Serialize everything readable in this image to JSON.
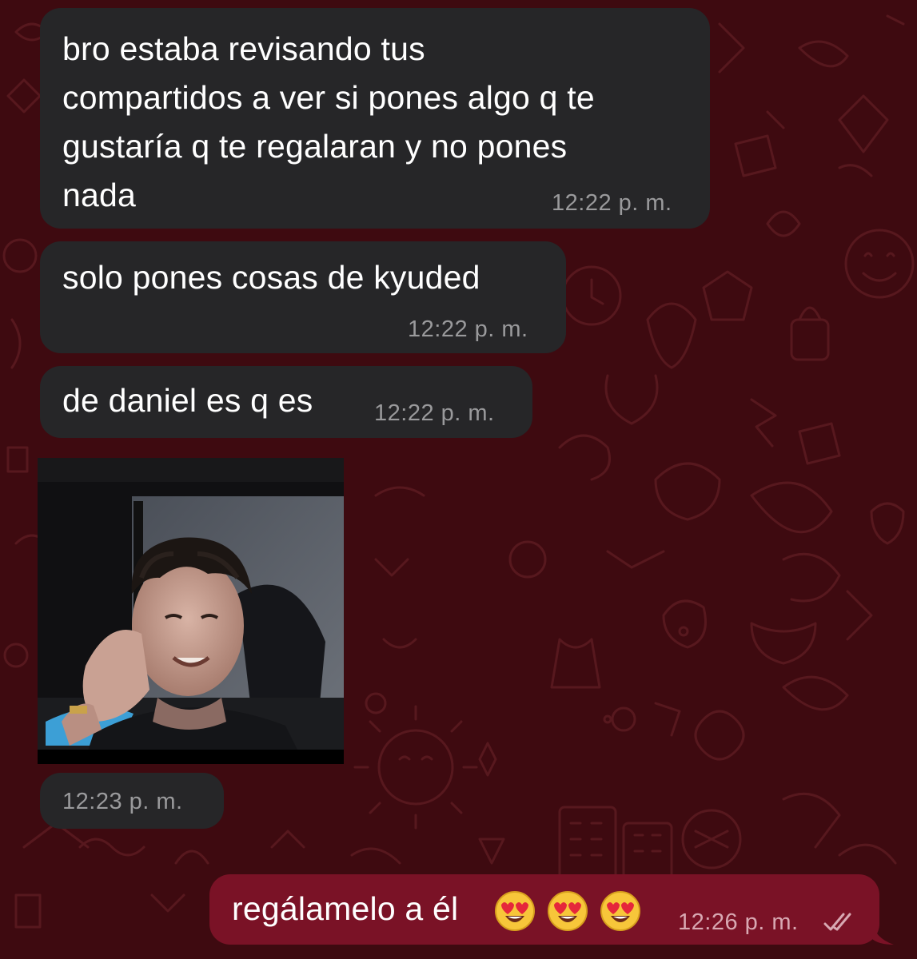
{
  "chat": {
    "messages": [
      {
        "direction": "incoming",
        "text": "bro estaba revisando tus compartidos a ver si pones algo q te gustaría q te regalaran y no pones nada",
        "lines": [
          "bro estaba revisando tus",
          "compartidos a ver si pones algo q te",
          "gustaría q te regalaran y no pones",
          "nada"
        ],
        "time": "12:22 p. m."
      },
      {
        "direction": "incoming",
        "text": "solo pones cosas de kyuded",
        "time": "12:22 p. m."
      },
      {
        "direction": "incoming",
        "text": "de daniel es q es",
        "time": "12:22 p. m."
      },
      {
        "direction": "incoming",
        "type": "image",
        "image_icon": "photo-of-person",
        "time": "12:23 p. m."
      },
      {
        "direction": "outgoing",
        "text": "regálamelo a él",
        "emojis": [
          "😍",
          "😍",
          "😍"
        ],
        "time": "12:26 p. m.",
        "status_icon": "double-check-icon"
      }
    ]
  },
  "colors": {
    "background": "#3e0a10",
    "incoming_bubble": "#262628",
    "outgoing_bubble": "#7a1226",
    "timestamp": "#9a9a9c"
  }
}
